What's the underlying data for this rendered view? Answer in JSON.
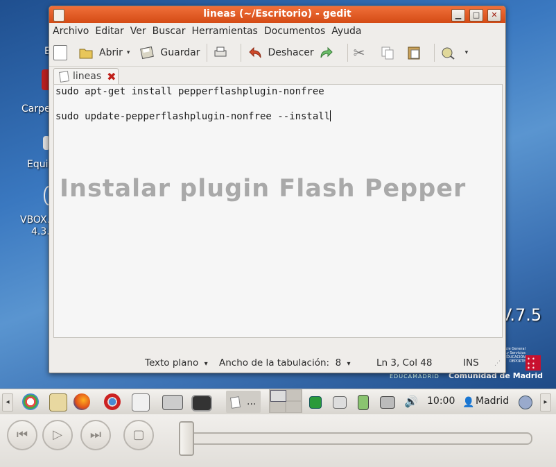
{
  "desktop": {
    "icon_labels": [
      "E",
      "Carpe",
      "Equi",
      "VBOX.",
      "4.3."
    ],
    "version": "V.7.5",
    "brand_small": [
      "...cie General",
      "...y Servicios",
      "EDUCACIÓN",
      "DEPORTE"
    ],
    "educamadrid": "EDUCAMADRID",
    "comunidad": "Comunidad de Madrid"
  },
  "window": {
    "title": "lineas (~/Escritorio) - gedit",
    "controls": {
      "minimize": "▁",
      "maximize": "□",
      "close": "✕"
    }
  },
  "menu": [
    "Archivo",
    "Editar",
    "Ver",
    "Buscar",
    "Herramientas",
    "Documentos",
    "Ayuda"
  ],
  "toolbar": {
    "open_label": "Abrir",
    "save_label": "Guardar",
    "undo_label": "Deshacer",
    "dropdown_arrow": "▾"
  },
  "tab": {
    "label": "lineas",
    "close": "✖"
  },
  "editor": {
    "lines": [
      "sudo apt-get install pepperflashplugin-nonfree",
      "",
      "sudo update-pepperflashplugin-nonfree --install"
    ],
    "overlay_text": "Instalar plugin Flash Pepper"
  },
  "statusbar": {
    "language": "Texto plano",
    "tab_width": "Ancho de la tabulación:  8",
    "position": "Ln 3, Col 48",
    "mode": "INS",
    "arrow": "▾"
  },
  "taskbar": {
    "left_arrow": "◂",
    "right_arrow": "▸",
    "active_app": "...",
    "clock": "10:00",
    "user": "Madrid"
  },
  "player": {
    "rewind": "⏮",
    "play": "▷",
    "forward": "⏭",
    "stop": "▢"
  },
  "colors": {
    "titlebar": "#e05a22",
    "desktop": "#3a78c0",
    "overlay": "#a9a9a9"
  }
}
